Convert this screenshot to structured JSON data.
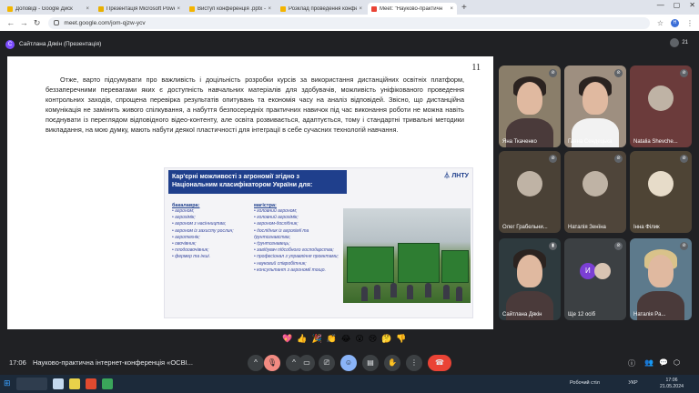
{
  "browser": {
    "tabs": [
      {
        "label": "Доповіді - Google Диск",
        "color": "#f2b600",
        "active": false
      },
      {
        "label": "Презентація Microsoft Powe",
        "color": "#e8b000",
        "active": false
      },
      {
        "label": "Виступ конференція .pptx - G",
        "color": "#f4b400",
        "active": false
      },
      {
        "label": "Розклад проведення конфер",
        "color": "#f4b400",
        "active": false
      },
      {
        "label": "Meet: \"Науково-практичн",
        "color": "#ea4335",
        "active": true
      }
    ],
    "new_tab": "+",
    "url": "meet.google.com/jom-qjzw-ycv",
    "profile_initial": "Н"
  },
  "meet": {
    "presenter_initial": "С",
    "presenter_label": "Сайтлана Дякін (Презентація)",
    "participant_count": "21",
    "tiles": [
      {
        "name": "Яна Ткаченко",
        "bg": "#8a7e6a"
      },
      {
        "name": "Ганна Сендецька",
        "bg": "#9e8f80"
      },
      {
        "name": "Natalia Shevche...",
        "bg": "#6b3b3b"
      },
      {
        "name": "Олег Грабельни...",
        "bg": "#4a4136"
      },
      {
        "name": "Наталія Зенїна",
        "bg": "#4f453a"
      },
      {
        "name": "Інна Філик",
        "bg": "#4e4435"
      },
      {
        "name": "Сайтлана Дякін",
        "bg": "#2e3a3e"
      },
      {
        "name": "Ще 12 осіб",
        "bg": "#3c4043"
      },
      {
        "name": "Наталія Ра...",
        "bg": "#5d7a8c"
      }
    ],
    "others_initial": "И",
    "reactions": [
      "💖",
      "👍",
      "🎉",
      "👏",
      "😂",
      "😮",
      "😢",
      "🤔",
      "👎"
    ],
    "clock": "17:06",
    "meeting_title": "Науково-практична інтернет-конференція «ОСВІ...",
    "more_label": "⋮"
  },
  "slide": {
    "number": "11",
    "paragraph": "Отже, варто підсумувати про важливість і доцільність розробки курсів за використання дистанційних освітніх платформ, беззаперечними перевагами яких є доступність навчальних матеріалів для здобувачів, можливість уніфікованого проведення контрольних заходів, спрощена перевірка результатів опитувань та економія часу на аналіз відповідей. Звісно, що дистанційна комунікація не замінить живого спілкування, а набуття безпосередніх практичних навичок під час виконання роботи не можна навіть поєднувати із переглядом відповідного відео-контенту, але освіта розвивається, адаптується, тому і стандартні тривальні методики викладання, на мою думку, мають набути деякої пластичності для інтеграції в себе сучасних технологій навчання.",
    "inner_title": "Кар'єрні можливості з агрономії згідно з Національним класифікатором України для:",
    "logo": "ЛНТУ",
    "bachelor_heading": "бакалавра:",
    "bachelor_items": [
      "агроном;",
      "агрохімік;",
      "агроном з насінництва;",
      "агроном із захисту рослин;",
      "агротехнік;",
      "овочівник;",
      "плодоовочівник;",
      "фермер та інші."
    ],
    "master_heading": "магістра:",
    "master_items": [
      "головний агроном;",
      "головний агрохімік;",
      "агроном-дослідник;",
      "дослідник із агрохімії та ґрунтознавства;",
      "ґрунтознавець;",
      "завідувач підсобного господарства;",
      "професіонал з управління проектами;",
      "науковий співробітник;",
      "консультант з агрономії тощо."
    ]
  },
  "taskbar": {
    "tray": "Робочий стіл",
    "lang": "УКР",
    "time": "17:06",
    "date": "21.05.2024"
  }
}
